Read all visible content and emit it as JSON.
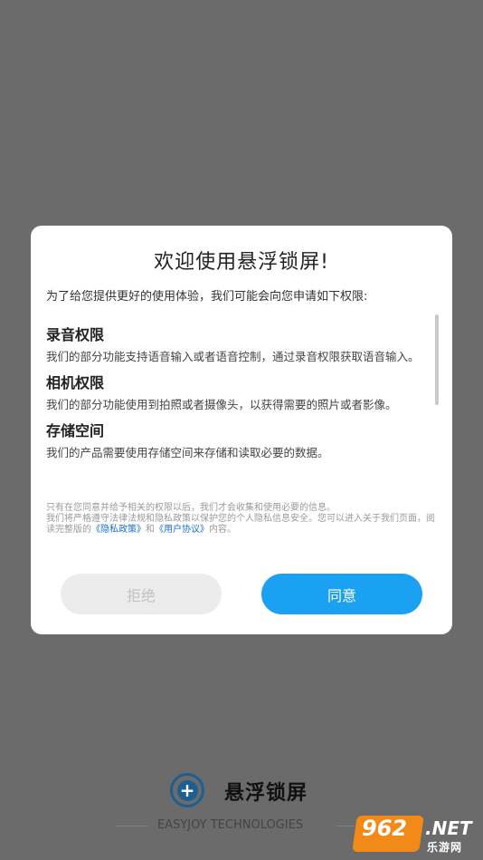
{
  "dialog": {
    "title": "欢迎使用悬浮锁屏!",
    "intro": "为了给您提供更好的使用体验，我们可能会向您申请如下权限:",
    "permissions": [
      {
        "heading": "录音权限",
        "desc": "我们的部分功能支持语音输入或者语音控制，通过录音权限获取语音输入。"
      },
      {
        "heading": "相机权限",
        "desc": "我们的部分功能使用到拍照或者摄像头，以获得需要的照片或者影像。"
      },
      {
        "heading": "存储空间",
        "desc": "我们的产品需要使用存储空间来存储和读取必要的数据。"
      }
    ],
    "notice": {
      "line1": "只有在您同意并给予相关的权限以后，我们才会收集和使用必要的信息。",
      "line2_pre": "我们将严格遵守法律法规和隐私政策以保护您的个人隐私信息安全。您可以进入关于我们页面，阅读完整版的",
      "privacy_link": "《隐私政策》",
      "and": "和",
      "agreement_link": "《用户协议》",
      "suffix": "内容。"
    },
    "reject_label": "拒绝",
    "agree_label": "同意"
  },
  "brand": {
    "icon": "plus-circle-icon",
    "name": "悬浮锁屏",
    "tagline": "EASYJOY TECHNOLOGIES"
  },
  "watermark": {
    "number": "962",
    "suffix": ".NET",
    "subtitle": "乐游网"
  },
  "colors": {
    "accent": "#1ba1f2",
    "brand": "#1c5f90",
    "link": "#1a6fd0",
    "overlay": "#6b6b6b"
  }
}
